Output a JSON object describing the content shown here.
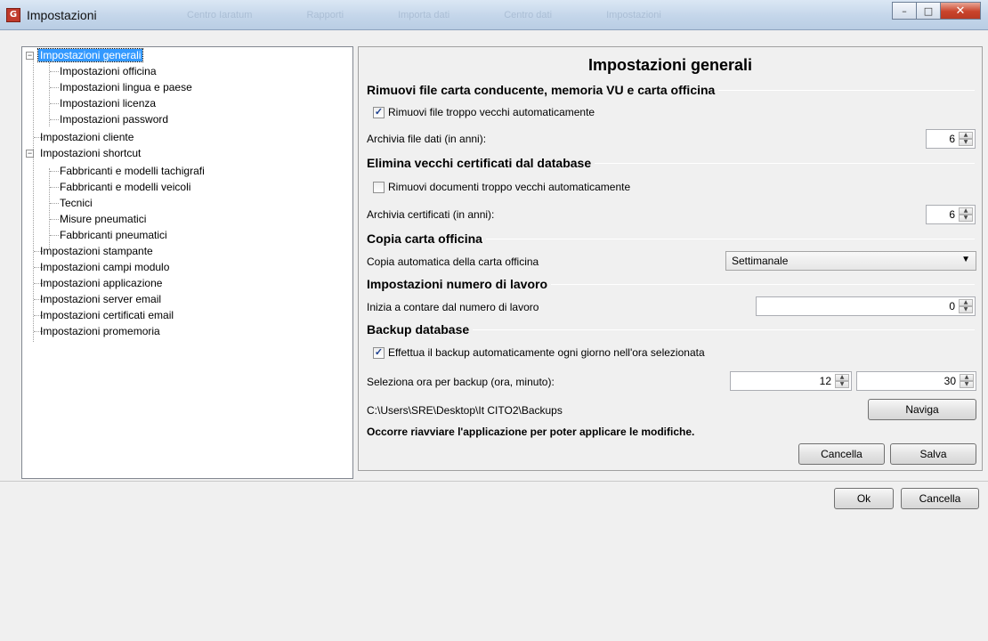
{
  "window": {
    "title": "Impostazioni",
    "app_icon": "G",
    "background_tabs": [
      "Centro Iaratum",
      "Rapporti",
      "Importa dati",
      "Centro dati",
      "Impostazioni"
    ],
    "minimize_glyph": "–",
    "maximize_glyph": "□",
    "close_glyph": "✕"
  },
  "tree": {
    "items": [
      {
        "label": "Impostazioni generali",
        "level": 0,
        "expander": "−",
        "selected": true
      },
      {
        "label": "Impostazioni officina",
        "level": 1
      },
      {
        "label": "Impostazioni lingua e paese",
        "level": 1
      },
      {
        "label": "Impostazioni licenza",
        "level": 1
      },
      {
        "label": "Impostazioni password",
        "level": 1
      },
      {
        "label": "Impostazioni cliente",
        "level": 0
      },
      {
        "label": "Impostazioni shortcut",
        "level": 0,
        "expander": "−"
      },
      {
        "label": "Fabbricanti e modelli tachigrafi",
        "level": 1
      },
      {
        "label": "Fabbricanti e modelli veicoli",
        "level": 1
      },
      {
        "label": "Tecnici",
        "level": 1
      },
      {
        "label": "Misure pneumatici",
        "level": 1
      },
      {
        "label": "Fabbricanti pneumatici",
        "level": 1
      },
      {
        "label": "Impostazioni stampante",
        "level": 0
      },
      {
        "label": "Impostazioni campi modulo",
        "level": 0
      },
      {
        "label": "Impostazioni applicazione",
        "level": 0
      },
      {
        "label": "Impostazioni server email",
        "level": 0
      },
      {
        "label": "Impostazioni certificati email",
        "level": 0
      },
      {
        "label": "Impostazioni promemoria",
        "level": 0
      }
    ]
  },
  "settings": {
    "title": "Impostazioni generali",
    "sec_files": "Rimuovi file carta conducente, memoria VU e carta officina",
    "chk_remove_files": "Rimuovi file troppo vecchi automaticamente",
    "chk_remove_files_checked": true,
    "archive_files_label": "Archivia file dati (in anni):",
    "archive_files_value": "6",
    "sec_certs": "Elimina vecchi certificati dal database",
    "chk_remove_docs": "Rimuovi documenti troppo vecchi automaticamente",
    "chk_remove_docs_checked": false,
    "archive_certs_label": "Archivia certificati (in anni):",
    "archive_certs_value": "6",
    "sec_copy": "Copia carta officina",
    "copy_label": "Copia automatica della carta officina",
    "copy_value": "Settimanale",
    "sec_jobnum": "Impostazioni numero di lavoro",
    "jobnum_label": "Inizia a contare dal numero di lavoro",
    "jobnum_value": "0",
    "sec_backup": "Backup database",
    "chk_backup": "Effettua il backup automaticamente ogni giorno nell'ora selezionata",
    "chk_backup_checked": true,
    "backup_time_label": "Seleziona ora per backup (ora, minuto):",
    "backup_hour": "12",
    "backup_minute": "30",
    "backup_path": "C:\\Users\\SRE\\Desktop\\It CITO2\\Backups",
    "browse_button": "Naviga",
    "restart_note": "Occorre riavviare l'applicazione per poter applicare le modifiche.",
    "cancel_button": "Cancella",
    "save_button": "Salva"
  },
  "footer": {
    "ok_button": "Ok",
    "cancel_button": "Cancella"
  },
  "glyphs": {
    "check": "✓",
    "spin_up": "▲",
    "spin_down": "▼",
    "combo_caret": "▼"
  }
}
